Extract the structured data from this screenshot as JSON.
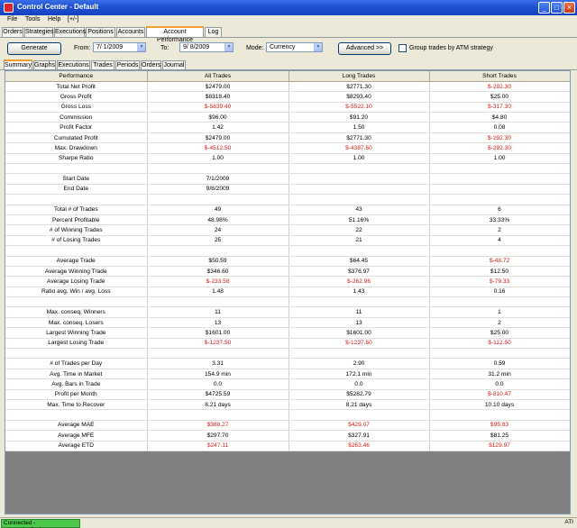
{
  "window": {
    "title": "Control Center - Default"
  },
  "menu": [
    "File",
    "Tools",
    "Help",
    "[+/-]"
  ],
  "main_tabs": [
    {
      "label": "Orders"
    },
    {
      "label": "Strategies"
    },
    {
      "label": "Executions"
    },
    {
      "label": "Positions"
    },
    {
      "label": "Accounts"
    },
    {
      "label": "Account Performance",
      "active": true
    },
    {
      "label": "Log"
    }
  ],
  "controls": {
    "generate_label": "Generate",
    "from_label": "From:",
    "from_value": "7/ 1/2009",
    "to_label": "To:",
    "to_value": "9/ 8/2009",
    "mode_label": "Mode:",
    "mode_value": "Currency",
    "advanced_label": "Advanced >>",
    "group_label": "Group trades by ATM strategy"
  },
  "sub_tabs": [
    {
      "label": "Summary",
      "active": true
    },
    {
      "label": "Graphs"
    },
    {
      "label": "Executions"
    },
    {
      "label": "Trades"
    },
    {
      "label": "Periods"
    },
    {
      "label": "Orders"
    },
    {
      "label": "Journal"
    }
  ],
  "table": {
    "headers": [
      "Performance",
      "All Trades",
      "Long Trades",
      "Short Trades"
    ],
    "rows": [
      {
        "label": "Total Net Profit",
        "all": "$2479.00",
        "long": "$2771.30",
        "short": "$-292.30",
        "neg": [
          false,
          false,
          true
        ]
      },
      {
        "label": "Gross Profit",
        "all": "$8318.40",
        "long": "$8293.40",
        "short": "$25.00",
        "neg": [
          false,
          false,
          false
        ]
      },
      {
        "label": "Gross Loss",
        "all": "$-5839.40",
        "long": "$-5522.10",
        "short": "$-317.30",
        "neg": [
          true,
          true,
          true
        ]
      },
      {
        "label": "Commission",
        "all": "$96.00",
        "long": "$91.20",
        "short": "$4.80",
        "neg": [
          false,
          false,
          false
        ]
      },
      {
        "label": "Profit Factor",
        "all": "1.42",
        "long": "1.50",
        "short": "0.08",
        "neg": [
          false,
          false,
          false
        ]
      },
      {
        "label": "Cumulated Profit",
        "all": "$2479.00",
        "long": "$2771.30",
        "short": "$-292.30",
        "neg": [
          false,
          false,
          true
        ]
      },
      {
        "label": "Max. Drawdown",
        "all": "$-4512.50",
        "long": "$-4387.50",
        "short": "$-292.30",
        "neg": [
          true,
          true,
          true
        ]
      },
      {
        "label": "Sharpe Ratio",
        "all": "1.00",
        "long": "1.00",
        "short": "1.00",
        "neg": [
          false,
          false,
          false
        ]
      },
      {
        "blank": true
      },
      {
        "label": "Start Date",
        "all": "7/1/2009",
        "long": "",
        "short": "",
        "neg": [
          false,
          false,
          false
        ]
      },
      {
        "label": "End Date",
        "all": "9/8/2009",
        "long": "",
        "short": "",
        "neg": [
          false,
          false,
          false
        ]
      },
      {
        "blank": true
      },
      {
        "label": "Total # of Trades",
        "all": "49",
        "long": "43",
        "short": "6",
        "neg": [
          false,
          false,
          false
        ]
      },
      {
        "label": "Percent Profitable",
        "all": "48.98%",
        "long": "51.16%",
        "short": "33.33%",
        "neg": [
          false,
          false,
          false
        ]
      },
      {
        "label": "# of Winning Trades",
        "all": "24",
        "long": "22",
        "short": "2",
        "neg": [
          false,
          false,
          false
        ]
      },
      {
        "label": "# of Losing Trades",
        "all": "25",
        "long": "21",
        "short": "4",
        "neg": [
          false,
          false,
          false
        ]
      },
      {
        "blank": true
      },
      {
        "label": "Average Trade",
        "all": "$50.59",
        "long": "$64.45",
        "short": "$-48.72",
        "neg": [
          false,
          false,
          true
        ]
      },
      {
        "label": "Average Winning Trade",
        "all": "$346.60",
        "long": "$376.97",
        "short": "$12.50",
        "neg": [
          false,
          false,
          false
        ]
      },
      {
        "label": "Average Losing Trade",
        "all": "$-233.58",
        "long": "$-262.96",
        "short": "$-79.33",
        "neg": [
          true,
          true,
          true
        ]
      },
      {
        "label": "Ratio avg. Win / avg. Loss",
        "all": "1.48",
        "long": "1.43",
        "short": "0.16",
        "neg": [
          false,
          false,
          false
        ]
      },
      {
        "blank": true
      },
      {
        "label": "Max. conseq. Winners",
        "all": "11",
        "long": "11",
        "short": "1",
        "neg": [
          false,
          false,
          false
        ]
      },
      {
        "label": "Max. conseq. Losers",
        "all": "13",
        "long": "13",
        "short": "2",
        "neg": [
          false,
          false,
          false
        ]
      },
      {
        "label": "Largest Winning Trade",
        "all": "$1601.00",
        "long": "$1601.00",
        "short": "$25.00",
        "neg": [
          false,
          false,
          false
        ]
      },
      {
        "label": "Largest Losing Trade",
        "all": "$-1237.50",
        "long": "$-1237.50",
        "short": "$-112.50",
        "neg": [
          true,
          true,
          true
        ]
      },
      {
        "blank": true
      },
      {
        "label": "# of Trades per Day",
        "all": "3.31",
        "long": "2.90",
        "short": "0.59",
        "neg": [
          false,
          false,
          false
        ]
      },
      {
        "label": "Avg. Time in Market",
        "all": "154.9 min",
        "long": "172.1 min",
        "short": "31.2 min",
        "neg": [
          false,
          false,
          false
        ]
      },
      {
        "label": "Avg. Bars in Trade",
        "all": "0.0",
        "long": "0.0",
        "short": "0.0",
        "neg": [
          false,
          false,
          false
        ]
      },
      {
        "label": "Profit per Month",
        "all": "$4725.59",
        "long": "$5282.79",
        "short": "$-810.47",
        "neg": [
          false,
          false,
          true
        ]
      },
      {
        "label": "Max. Time to Recover",
        "all": "8.21 days",
        "long": "8.21 days",
        "short": "10.10 days",
        "neg": [
          false,
          false,
          false
        ]
      },
      {
        "blank": true
      },
      {
        "label": "Average MAE",
        "all": "$388.27",
        "long": "$429.07",
        "short": "$95.83",
        "neg": [
          true,
          true,
          true
        ]
      },
      {
        "label": "Average MFE",
        "all": "$297.70",
        "long": "$327.91",
        "short": "$81.25",
        "neg": [
          false,
          false,
          false
        ]
      },
      {
        "label": "Average ETD",
        "all": "$247.11",
        "long": "$263.46",
        "short": "$129.97",
        "neg": [
          true,
          true,
          true
        ]
      }
    ]
  },
  "status": {
    "connection": "Connected - InteractiveBrokers",
    "right": "ATI"
  },
  "colors": {
    "negative": "#d61c1c",
    "title_bar": "#1f4fd0",
    "connected": "#4cc84c"
  }
}
